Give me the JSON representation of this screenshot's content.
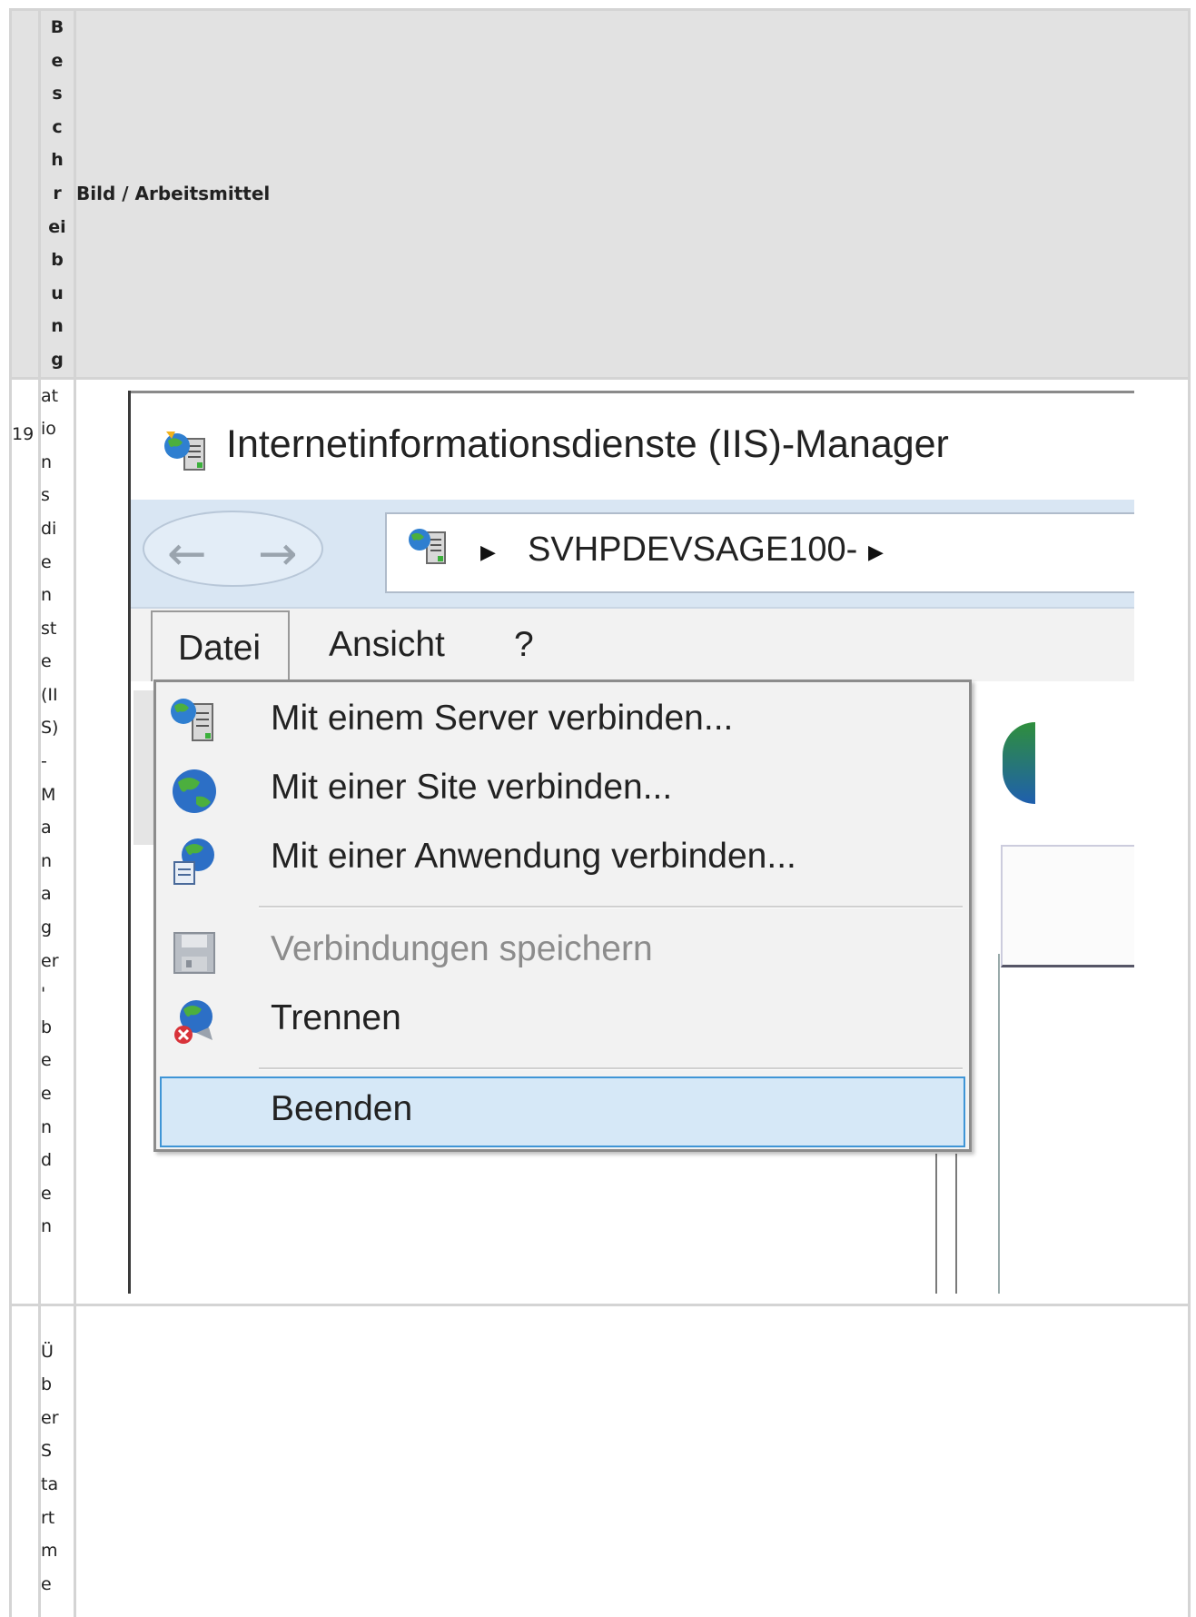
{
  "table": {
    "header": {
      "description_letters": [
        "B",
        "e",
        "s",
        "c",
        "h",
        "r",
        "ei",
        "b",
        "u",
        "n",
        "g"
      ],
      "image_header": "Bild / Arbeitsmittel"
    },
    "row1": {
      "number_lines": [
        "1",
        "9"
      ],
      "description_lines": [
        "at",
        "io",
        "n",
        "s",
        "di",
        "e",
        "n",
        "st",
        "e",
        "(II",
        "S)",
        "-",
        "M",
        "a",
        "n",
        "a",
        "g",
        "er",
        "'",
        "b",
        "e",
        "e",
        "n",
        "d",
        "e",
        "n"
      ]
    },
    "row2": {
      "description_lines": [
        "Ü",
        "b",
        "er",
        "S",
        "ta",
        "rt",
        "m",
        "e"
      ]
    }
  },
  "screenshot": {
    "window_title": "Internetinformationsdienste (IIS)-Manager",
    "address": "SVHPDEVSAGE100-",
    "menu": [
      "Datei",
      "Ansicht",
      "?"
    ],
    "dropdown": [
      {
        "label": "Mit einem Server verbinden...",
        "icon": "server-icon",
        "disabled": false
      },
      {
        "label": "Mit einer Site verbinden...",
        "icon": "globe-icon",
        "disabled": false
      },
      {
        "label": "Mit einer Anwendung verbinden...",
        "icon": "application-globe-icon",
        "disabled": false
      },
      {
        "label": "Verbindungen speichern",
        "icon": "save-disk-icon",
        "disabled": true
      },
      {
        "label": "Trennen",
        "icon": "disconnect-icon",
        "disabled": false
      },
      {
        "label": "Beenden",
        "icon": "",
        "disabled": false,
        "selected": true
      }
    ],
    "colors": {
      "nav_bar": "#d9e6f3",
      "menu_bg": "#f2f2f2",
      "selected_bg": "#d6e8f7",
      "selected_border": "#3f95d6",
      "table_border": "#d4d4d4",
      "header_bg": "#e2e2e2"
    }
  }
}
